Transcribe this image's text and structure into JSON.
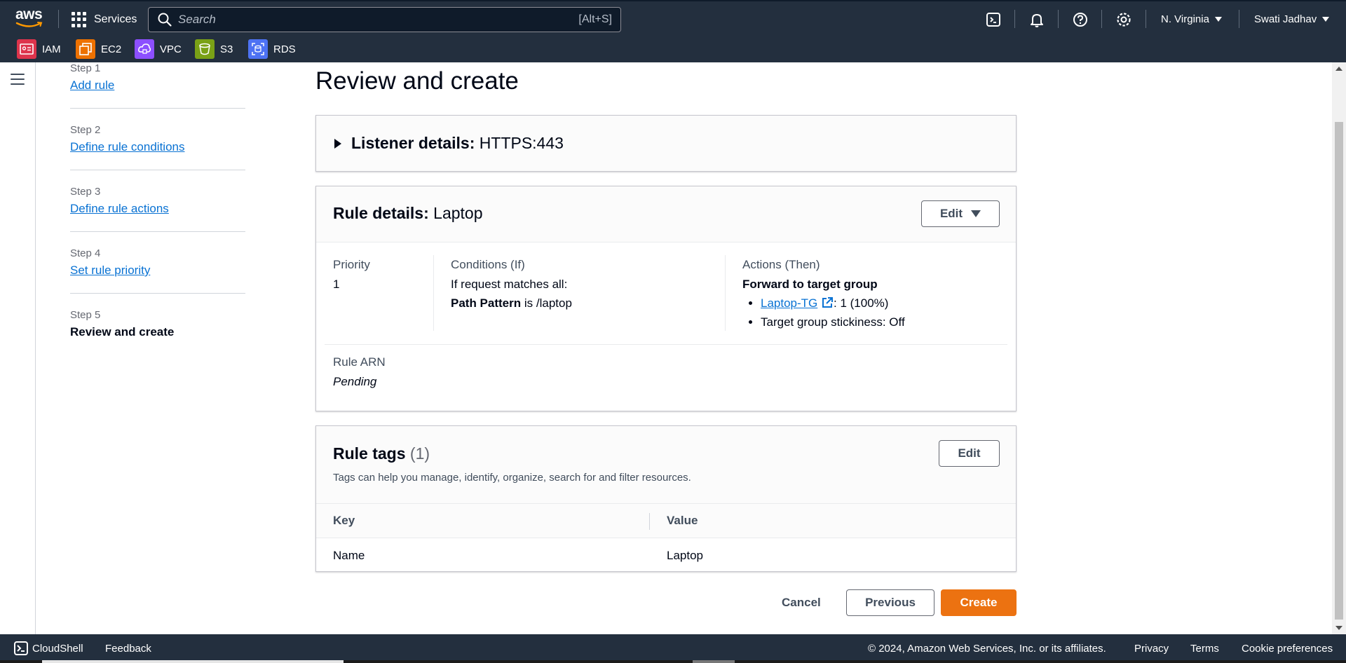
{
  "topbar": {
    "logo": "aws",
    "services_label": "Services",
    "search_placeholder": "Search",
    "search_shortcut": "[Alt+S]",
    "region": "N. Virginia",
    "user": "Swati Jadhav",
    "icons": [
      "cloudshell-icon",
      "bell-icon",
      "help-icon",
      "settings-icon"
    ]
  },
  "favorites": [
    {
      "label": "IAM",
      "color": "#dd344c"
    },
    {
      "label": "EC2",
      "color": "#ed7100"
    },
    {
      "label": "VPC",
      "color": "#8c4fff"
    },
    {
      "label": "S3",
      "color": "#7aa116"
    },
    {
      "label": "RDS",
      "color": "#4d72f3"
    }
  ],
  "steps": [
    {
      "num": "Step 1",
      "label": "Add rule"
    },
    {
      "num": "Step 2",
      "label": "Define rule conditions"
    },
    {
      "num": "Step 3",
      "label": "Define rule actions"
    },
    {
      "num": "Step 4",
      "label": "Set rule priority"
    },
    {
      "num": "Step 5",
      "label": "Review and create"
    }
  ],
  "page_title": "Review and create",
  "listener": {
    "heading": "Listener details:",
    "value": "HTTPS:443"
  },
  "rule": {
    "heading": "Rule details:",
    "value": "Laptop",
    "edit_label": "Edit",
    "priority_label": "Priority",
    "priority_value": "1",
    "conditions_label": "Conditions (If)",
    "conditions_line1": "If request matches all:",
    "conditions_bold": "Path Pattern",
    "conditions_rest": " is /laptop",
    "actions_label": "Actions (Then)",
    "actions_title": "Forward to target group",
    "target_link": "Laptop-TG",
    "target_weight": ": 1 (100%)",
    "stickiness": "Target group stickiness: Off",
    "arn_label": "Rule ARN",
    "arn_value": "Pending"
  },
  "tags": {
    "heading": "Rule tags",
    "count": "(1)",
    "description": "Tags can help you manage, identify, organize, search for and filter resources.",
    "edit_label": "Edit",
    "columns": [
      "Key",
      "Value"
    ],
    "rows": [
      {
        "key": "Name",
        "value": "Laptop"
      }
    ]
  },
  "actions": {
    "cancel": "Cancel",
    "previous": "Previous",
    "create": "Create"
  },
  "footer": {
    "cloudshell": "CloudShell",
    "feedback": "Feedback",
    "copyright": "© 2024, Amazon Web Services, Inc. or its affiliates.",
    "privacy": "Privacy",
    "terms": "Terms",
    "cookies": "Cookie preferences"
  }
}
